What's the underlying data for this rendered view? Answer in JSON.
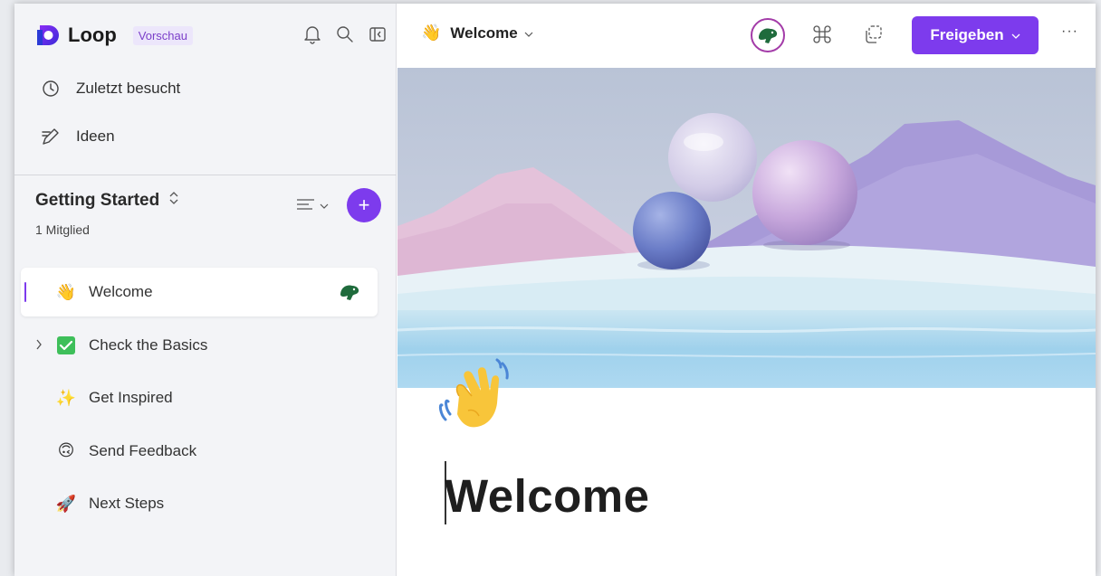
{
  "app": {
    "name": "Loop",
    "badge": "Vorschau"
  },
  "sidebar": {
    "nav": [
      {
        "label": "Zuletzt besucht",
        "icon": "clock-icon"
      },
      {
        "label": "Ideen",
        "icon": "pencil-lines-icon"
      }
    ],
    "workspace": {
      "title": "Getting Started",
      "members": "1 Mitglied",
      "add_label": "+"
    },
    "pages": [
      {
        "label": "Welcome",
        "emoji": "👋",
        "active": true
      },
      {
        "label": "Check the Basics",
        "emoji": "✅",
        "expandable": true
      },
      {
        "label": "Get Inspired",
        "emoji": "✨"
      },
      {
        "label": "Send Feedback",
        "emoji": "🙃"
      },
      {
        "label": "Next Steps",
        "emoji": "🚀"
      }
    ]
  },
  "topbar": {
    "doc_emoji": "👋",
    "doc_title": "Welcome",
    "share_label": "Freigeben",
    "more_label": "···"
  },
  "document": {
    "title": "Welcome",
    "emoji": "👋"
  },
  "colors": {
    "accent": "#7d3bed",
    "sidebar_bg": "#f3f4f7",
    "badge_bg": "#ece6fb",
    "badge_text": "#7b3fc9",
    "presence_ring": "#a33ba8",
    "avatar_green": "#1f6b3c"
  }
}
